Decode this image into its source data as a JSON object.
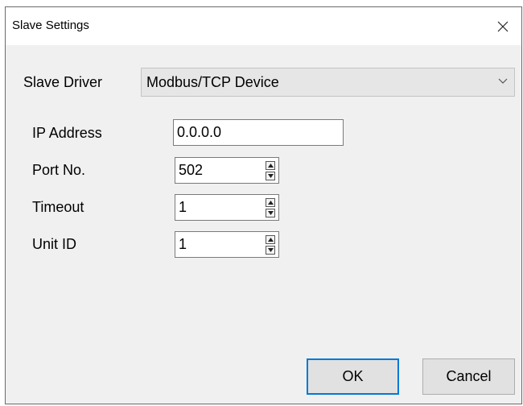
{
  "window": {
    "title": "Slave Settings"
  },
  "driver": {
    "label": "Slave Driver",
    "value": "Modbus/TCP Device"
  },
  "fields": [
    {
      "label": "IP Address",
      "value": "0.0.0.0"
    },
    {
      "label": "Port No.",
      "value": "502"
    },
    {
      "label": "Timeout",
      "value": "1"
    },
    {
      "label": "Unit ID",
      "value": "1"
    }
  ],
  "buttons": {
    "ok": "OK",
    "cancel": "Cancel"
  },
  "colors": {
    "accent": "#0078d7",
    "titlebar": "#ffffff",
    "client": "#f0f0f0"
  },
  "icons": {
    "close": "close-icon",
    "dropdown": "chevron-down-icon",
    "spin_up": "triangle-up-icon",
    "spin_down": "triangle-down-icon"
  }
}
